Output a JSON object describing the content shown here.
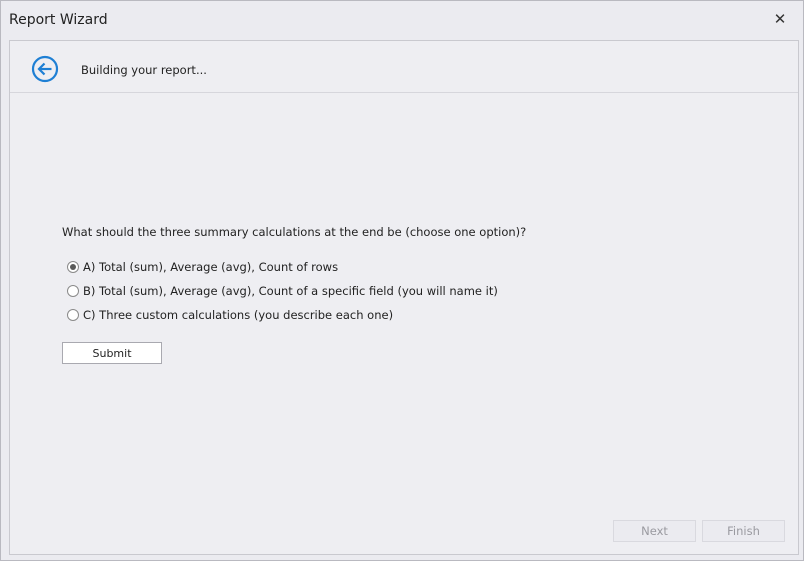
{
  "window": {
    "title": "Report Wizard",
    "close_glyph": "✕"
  },
  "header": {
    "back_icon": "arrow-left-circle-icon",
    "accent_color": "#1e7fd4",
    "text": "Building your report..."
  },
  "question": {
    "text": "What should the three summary calculations at the end be (choose one option)?",
    "options": [
      {
        "label": "A) Total (sum), Average (avg), Count of rows",
        "selected": true
      },
      {
        "label": "B) Total (sum), Average (avg), Count of a specific field (you will name it)",
        "selected": false
      },
      {
        "label": "C) Three custom calculations (you describe each one)",
        "selected": false
      }
    ]
  },
  "submit_label": "Submit",
  "footer": {
    "next_label": "Next",
    "finish_label": "Finish"
  }
}
